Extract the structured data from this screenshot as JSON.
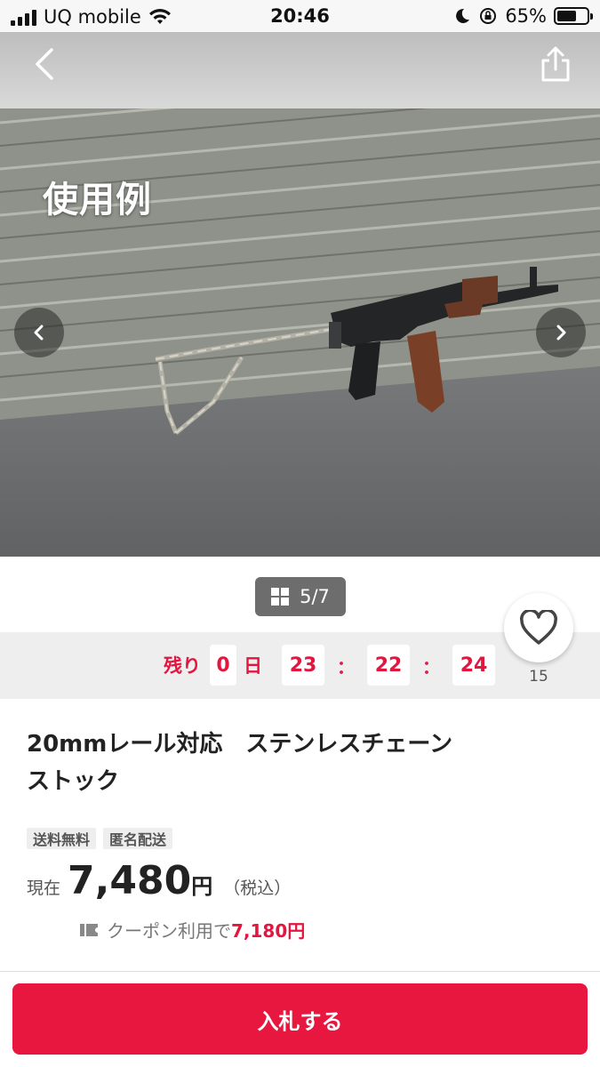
{
  "status_bar": {
    "carrier": "UQ mobile",
    "time": "20:46",
    "battery_percent": "65%",
    "battery_level": 0.65
  },
  "nav": {
    "back_icon": "chevron-left-icon",
    "share_icon": "share-icon"
  },
  "photo": {
    "caption": "使用例",
    "counter": "5/7"
  },
  "countdown": {
    "prefix": "残り",
    "days": "0",
    "days_unit": "日",
    "hours": "23",
    "minutes": "22",
    "seconds": "24",
    "separator": "："
  },
  "favorite": {
    "count": "15"
  },
  "item": {
    "title_line1": "20mmレール対応　ステンレスチェーン",
    "title_line2": "ストック",
    "tags": [
      "送料無料",
      "匿名配送"
    ],
    "price_label": "現在",
    "price": "7,480",
    "price_unit": "円",
    "tax": "（税込）",
    "coupon_text": "クーポン利用で",
    "coupon_price": "7,180円"
  },
  "actions": {
    "bid_label": "入札する"
  },
  "colors": {
    "accent": "#e8173f",
    "countdown_text": "#e3163f",
    "counter_bg": "#6d6d6d"
  }
}
